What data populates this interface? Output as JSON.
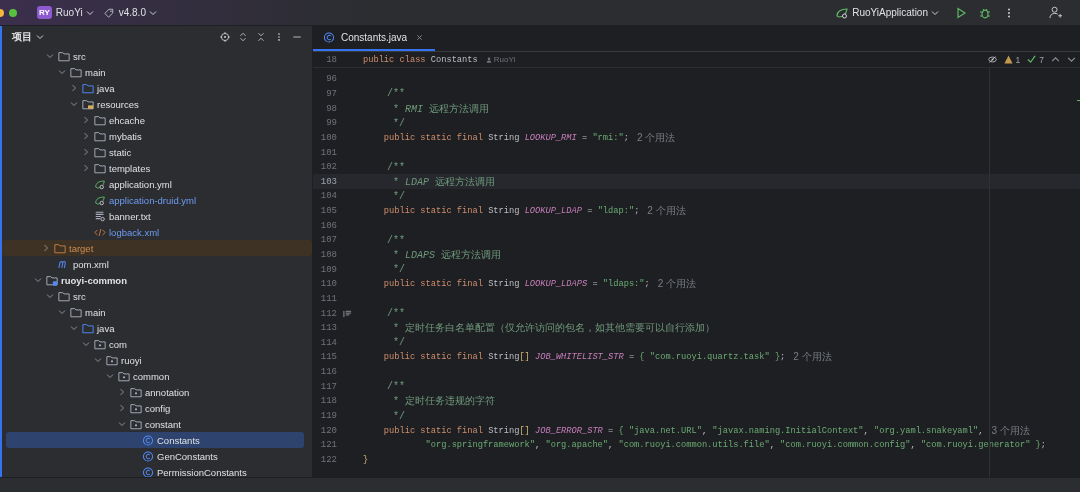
{
  "title_bar": {
    "project_badge": "RY",
    "project": "RuoYi",
    "branch": "v4.8.0",
    "run_config": "RuoYiApplication"
  },
  "sidebar": {
    "title": "项目",
    "continued_children": [
      {
        "label": "src",
        "kind": "folder",
        "expanded": true,
        "selected": false,
        "children": [
          {
            "label": "main",
            "kind": "folder",
            "expanded": true,
            "selected": false,
            "children": [
              {
                "label": "java",
                "kind": "source-folder",
                "expanded": false,
                "selected": false
              },
              {
                "label": "resources",
                "kind": "resources-folder",
                "expanded": true,
                "selected": false,
                "children": [
                  {
                    "label": "ehcache",
                    "kind": "folder",
                    "expanded": false,
                    "selected": false
                  },
                  {
                    "label": "mybatis",
                    "kind": "folder",
                    "expanded": false,
                    "selected": false
                  },
                  {
                    "label": "static",
                    "kind": "folder",
                    "expanded": false,
                    "selected": false
                  },
                  {
                    "label": "templates",
                    "kind": "folder",
                    "expanded": false,
                    "selected": false
                  },
                  {
                    "label": "application.yml",
                    "kind": "yaml",
                    "selected": false,
                    "modified": false
                  },
                  {
                    "label": "application-druid.yml",
                    "kind": "yaml",
                    "selected": false,
                    "modified": true
                  },
                  {
                    "label": "banner.txt",
                    "kind": "text",
                    "selected": false,
                    "modified": false
                  },
                  {
                    "label": "logback.xml",
                    "kind": "xml",
                    "selected": false,
                    "modified": true
                  }
                ]
              }
            ]
          }
        ]
      },
      {
        "label": "target",
        "kind": "folder",
        "expanded": false,
        "selected": false,
        "excluded": true
      },
      {
        "label": "pom.xml",
        "kind": "maven",
        "selected": false,
        "modified": false
      }
    ],
    "items": [
      {
        "label": "ruoyi-common",
        "kind": "module",
        "expanded": true,
        "selected": false,
        "children": [
          {
            "label": "src",
            "kind": "folder",
            "expanded": true,
            "selected": false,
            "children": [
              {
                "label": "main",
                "kind": "folder",
                "expanded": true,
                "selected": false,
                "children": [
                  {
                    "label": "java",
                    "kind": "source-folder",
                    "expanded": true,
                    "selected": false,
                    "children": [
                      {
                        "label": "com",
                        "kind": "package",
                        "expanded": true,
                        "selected": false,
                        "children": [
                          {
                            "label": "ruoyi",
                            "kind": "package",
                            "expanded": true,
                            "selected": false,
                            "children": [
                              {
                                "label": "common",
                                "kind": "package",
                                "expanded": true,
                                "selected": false,
                                "children": [
                                  {
                                    "label": "annotation",
                                    "kind": "package",
                                    "expanded": false,
                                    "selected": false
                                  },
                                  {
                                    "label": "config",
                                    "kind": "package",
                                    "expanded": false,
                                    "selected": false
                                  },
                                  {
                                    "label": "constant",
                                    "kind": "package",
                                    "expanded": true,
                                    "selected": false,
                                    "children": [
                                      {
                                        "label": "Constants",
                                        "kind": "class",
                                        "selected": true
                                      },
                                      {
                                        "label": "GenConstants",
                                        "kind": "class",
                                        "selected": false
                                      },
                                      {
                                        "label": "PermissionConstants",
                                        "kind": "class",
                                        "selected": false
                                      }
                                    ]
                                  }
                                ]
                              }
                            ]
                          }
                        ]
                      }
                    ]
                  }
                ]
              }
            ]
          }
        ]
      }
    ]
  },
  "editor": {
    "tabs": [
      {
        "label": "Constants.java",
        "selected": true
      }
    ],
    "inspections": {
      "warnings": "1",
      "checks": "7"
    },
    "sticky_line": {
      "number": "18",
      "tokens": [
        {
          "kind": "kw",
          "text": "public class "
        },
        {
          "kind": "text",
          "text": "Constants"
        }
      ],
      "author": "RuoYi"
    },
    "lines": [
      {
        "number": "96",
        "current": false
      },
      {
        "number": "97",
        "current": false,
        "tokens": [
          {
            "kind": "doc",
            "text": "    /**"
          }
        ]
      },
      {
        "number": "98",
        "current": false,
        "tokens": [
          {
            "kind": "doc",
            "text": "     * "
          },
          {
            "kind": "doc-em",
            "text": "RMI"
          },
          {
            "kind": "doc",
            "text": " 远程方法调用"
          }
        ]
      },
      {
        "number": "99",
        "current": false,
        "tokens": [
          {
            "kind": "doc",
            "text": "     */"
          }
        ]
      },
      {
        "number": "100",
        "current": false,
        "tokens": [
          {
            "kind": "kw",
            "text": "    public static final "
          },
          {
            "kind": "text",
            "text": "String "
          },
          {
            "kind": "const",
            "text": "LOOKUP_RMI"
          },
          {
            "kind": "text",
            "text": " = "
          },
          {
            "kind": "str",
            "text": "\"rmi:\""
          },
          {
            "kind": "text",
            "text": ";"
          }
        ],
        "hint": "2 个用法"
      },
      {
        "number": "101",
        "current": false
      },
      {
        "number": "102",
        "current": false,
        "tokens": [
          {
            "kind": "doc",
            "text": "    /**"
          }
        ]
      },
      {
        "number": "103",
        "current": true,
        "tokens": [
          {
            "kind": "doc",
            "text": "     * "
          },
          {
            "kind": "doc-em",
            "text": "LDAP"
          },
          {
            "kind": "doc",
            "text": " 远程方法调用"
          }
        ]
      },
      {
        "number": "104",
        "current": false,
        "tokens": [
          {
            "kind": "doc",
            "text": "     */"
          }
        ]
      },
      {
        "number": "105",
        "current": false,
        "tokens": [
          {
            "kind": "kw",
            "text": "    public static final "
          },
          {
            "kind": "text",
            "text": "String "
          },
          {
            "kind": "const",
            "text": "LOOKUP_LDAP"
          },
          {
            "kind": "text",
            "text": " = "
          },
          {
            "kind": "str",
            "text": "\"ldap:\""
          },
          {
            "kind": "text",
            "text": ";"
          }
        ],
        "hint": "2 个用法"
      },
      {
        "number": "106",
        "current": false
      },
      {
        "number": "107",
        "current": false,
        "tokens": [
          {
            "kind": "doc",
            "text": "    /**"
          }
        ]
      },
      {
        "number": "108",
        "current": false,
        "tokens": [
          {
            "kind": "doc",
            "text": "     * "
          },
          {
            "kind": "doc-em",
            "text": "LDAPS"
          },
          {
            "kind": "doc",
            "text": " 远程方法调用"
          }
        ]
      },
      {
        "number": "109",
        "current": false,
        "tokens": [
          {
            "kind": "doc",
            "text": "     */"
          }
        ]
      },
      {
        "number": "110",
        "current": false,
        "tokens": [
          {
            "kind": "kw",
            "text": "    public static final "
          },
          {
            "kind": "text",
            "text": "String "
          },
          {
            "kind": "const",
            "text": "LOOKUP_LDAPS"
          },
          {
            "kind": "text",
            "text": " = "
          },
          {
            "kind": "str",
            "text": "\"ldaps:\""
          },
          {
            "kind": "text",
            "text": ";"
          }
        ],
        "hint": "2 个用法"
      },
      {
        "number": "111",
        "current": false
      },
      {
        "number": "112",
        "current": false,
        "rendered_doc": true,
        "tokens": [
          {
            "kind": "doc",
            "text": "    /**"
          }
        ]
      },
      {
        "number": "113",
        "current": false,
        "tokens": [
          {
            "kind": "doc",
            "text": "     * 定时任务白名单配置（仅允许访问的包名，如其他需要可以自行添加）"
          }
        ]
      },
      {
        "number": "114",
        "current": false,
        "tokens": [
          {
            "kind": "doc",
            "text": "     */"
          }
        ]
      },
      {
        "number": "115",
        "current": false,
        "tokens": [
          {
            "kind": "kw",
            "text": "    public static final "
          },
          {
            "kind": "text",
            "text": "String"
          },
          {
            "kind": "bracket",
            "text": "[] "
          },
          {
            "kind": "const",
            "text": "JOB_WHITELIST_STR"
          },
          {
            "kind": "text",
            "text": " = "
          },
          {
            "kind": "str",
            "text": "{ \"com.ruoyi.quartz.task\" }"
          },
          {
            "kind": "text",
            "text": ";"
          }
        ],
        "hint": "2 个用法"
      },
      {
        "number": "116",
        "current": false
      },
      {
        "number": "117",
        "current": false,
        "tokens": [
          {
            "kind": "doc",
            "text": "    /**"
          }
        ]
      },
      {
        "number": "118",
        "current": false,
        "tokens": [
          {
            "kind": "doc",
            "text": "     * 定时任务违规的字符"
          }
        ]
      },
      {
        "number": "119",
        "current": false,
        "tokens": [
          {
            "kind": "doc",
            "text": "     */"
          }
        ]
      },
      {
        "number": "120",
        "current": false,
        "tokens": [
          {
            "kind": "kw",
            "text": "    public static final "
          },
          {
            "kind": "text",
            "text": "String"
          },
          {
            "kind": "bracket",
            "text": "[] "
          },
          {
            "kind": "const",
            "text": "JOB_ERROR_STR"
          },
          {
            "kind": "text",
            "text": " = "
          },
          {
            "kind": "str",
            "text": "{ \"java.net.URL\""
          },
          {
            "kind": "text",
            "text": ", "
          },
          {
            "kind": "str",
            "text": "\"javax.naming.InitialContext\""
          },
          {
            "kind": "text",
            "text": ", "
          },
          {
            "kind": "str",
            "text": "\"org.yaml.snakeyaml\""
          },
          {
            "kind": "text",
            "text": ","
          }
        ],
        "hint": "3 个用法"
      },
      {
        "number": "121",
        "current": false,
        "tokens": [
          {
            "kind": "str",
            "text": "            \"org.springframework\""
          },
          {
            "kind": "text",
            "text": ", "
          },
          {
            "kind": "str",
            "text": "\"org.apache\""
          },
          {
            "kind": "text",
            "text": ", "
          },
          {
            "kind": "str",
            "text": "\"com.ruoyi.common.utils.file\""
          },
          {
            "kind": "text",
            "text": ", "
          },
          {
            "kind": "str",
            "text": "\"com.ruoyi.common.config\""
          },
          {
            "kind": "text",
            "text": ", "
          },
          {
            "kind": "str",
            "text": "\"com.ruoyi.generator\" }"
          },
          {
            "kind": "text",
            "text": ";"
          }
        ]
      },
      {
        "number": "122",
        "current": false,
        "tokens": [
          {
            "kind": "bracket",
            "text": "}"
          }
        ]
      }
    ]
  }
}
